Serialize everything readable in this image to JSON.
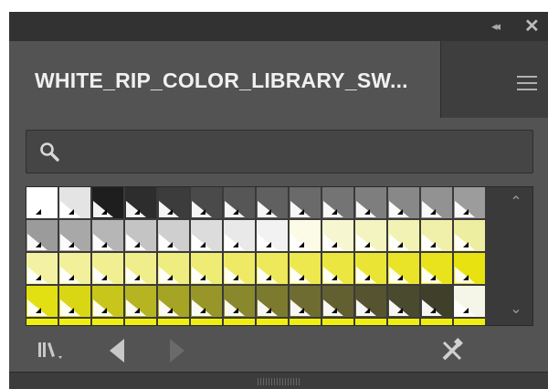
{
  "panel": {
    "tab_label": "WHITE_RIP_COLOR_LIBRARY_SW...",
    "collapse_glyph": "◂◂",
    "close_glyph": "✕"
  },
  "search": {
    "value": "",
    "placeholder": ""
  },
  "icons": {
    "collapse": "double-chevron-left-icon",
    "close": "close-icon",
    "menu": "hamburger-menu-icon",
    "search": "search-icon",
    "library": "swatch-libraries-menu-icon",
    "previous": "previous-library-icon",
    "next": "next-library-icon",
    "tool": "swatch-options-icon"
  },
  "swatches": [
    [
      "#ffffff",
      "#e4e4e4",
      "#1e1e1e",
      "#2d2d2d",
      "#3c3c3c",
      "#4a4a4a",
      "#565656",
      "#606060",
      "#6a6a6a",
      "#747474",
      "#7e7e7e",
      "#888888",
      "#929292",
      "#9c9c9c"
    ],
    [
      "#9b9b9b",
      "#a8a8a8",
      "#b6b6b6",
      "#c4c4c4",
      "#cfcfcf",
      "#dcdcdc",
      "#e9e9e9",
      "#f2f2f2",
      "#fbfbe6",
      "#f6f6d0",
      "#f4f4c0",
      "#f2f2b4",
      "#f0f0aa",
      "#eeeea0"
    ],
    [
      "#f3f1a2",
      "#f2f09a",
      "#f1ef92",
      "#f0ee8a",
      "#efed80",
      "#eeec74",
      "#eeea66",
      "#ede95a",
      "#ece84e",
      "#ebe640",
      "#eae534",
      "#e9e428",
      "#e8e31c",
      "#e7e210"
    ],
    [
      "#e2e012",
      "#d9d714",
      "#c8c61a",
      "#b6b420",
      "#a6a424",
      "#989628",
      "#8a882c",
      "#7c7a2e",
      "#6e6c30",
      "#626030",
      "#565430",
      "#4a4a2e",
      "#40402a",
      "#f6f6e8"
    ],
    [
      "#f0ee10",
      "#f0ee10",
      "#f0ee10",
      "#f0ee10",
      "#f0ee10",
      "#f0ee10",
      "#f0ee10",
      "#f0ee10",
      "#f0ee10",
      "#f0ee10",
      "#f0ee10",
      "#f0ee10",
      "#f0ee10",
      "#f0ee10"
    ]
  ]
}
